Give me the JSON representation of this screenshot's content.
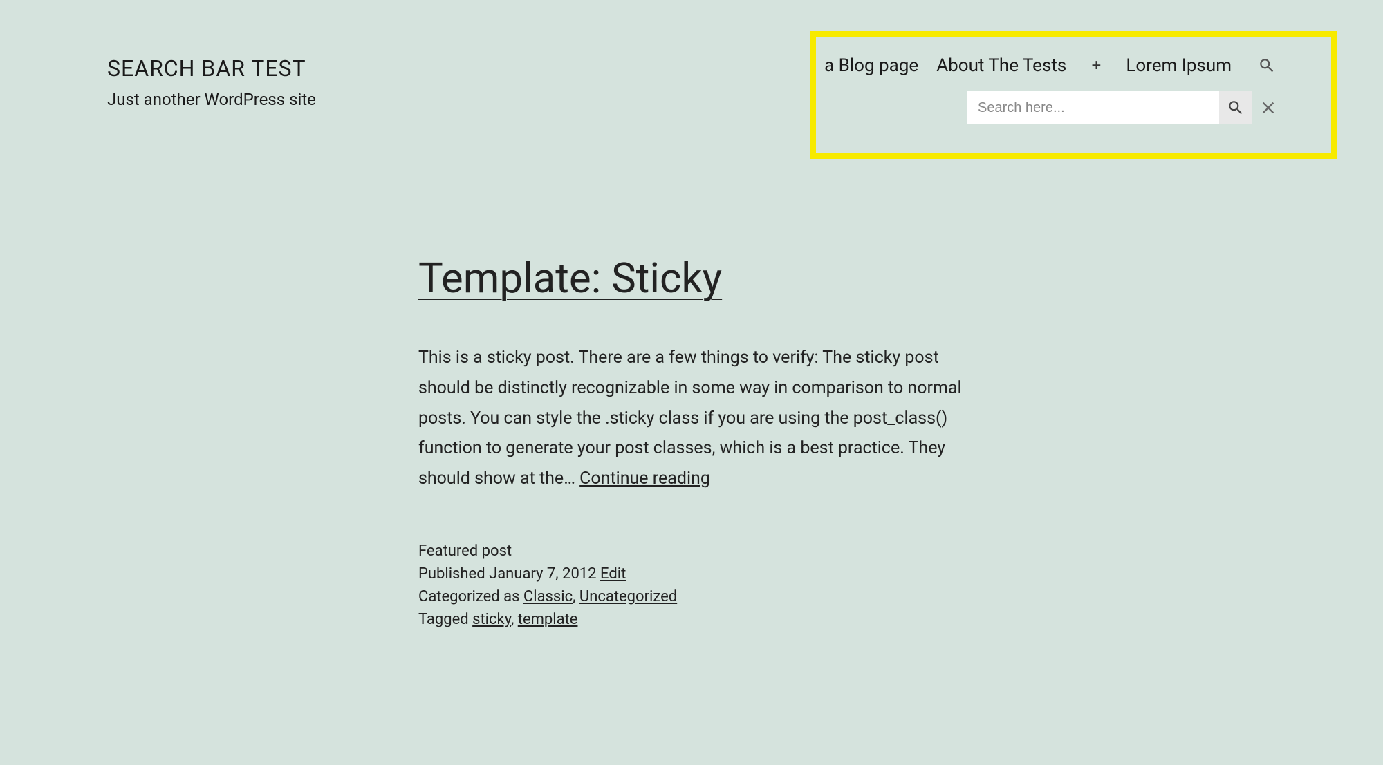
{
  "site": {
    "title": "SEARCH BAR TEST",
    "tagline": "Just another WordPress site"
  },
  "nav": {
    "items": [
      {
        "label": "a Blog page"
      },
      {
        "label": "About The Tests"
      },
      {
        "label": "Lorem Ipsum"
      }
    ],
    "plus": "+"
  },
  "search": {
    "placeholder": "Search here..."
  },
  "post": {
    "title": "Template: Sticky",
    "excerpt": "This is a sticky post. There are a few things to verify: The sticky post should be distinctly recognizable in some way in comparison to normal posts. You can style the .sticky class if you are using the post_class() function to generate your post classes, which is a best practice. They should show at the… ",
    "continue": "Continue reading",
    "meta": {
      "featured": "Featured post",
      "published_label": "Published ",
      "date": "January 7, 2012",
      "edit": "Edit",
      "categorized_label": "Categorized as ",
      "cat1": "Classic",
      "cat2": "Uncategorized",
      "tagged_label": "Tagged ",
      "tag1": "sticky",
      "tag2": "template",
      "comma": ", ",
      "spacer": "   "
    }
  }
}
